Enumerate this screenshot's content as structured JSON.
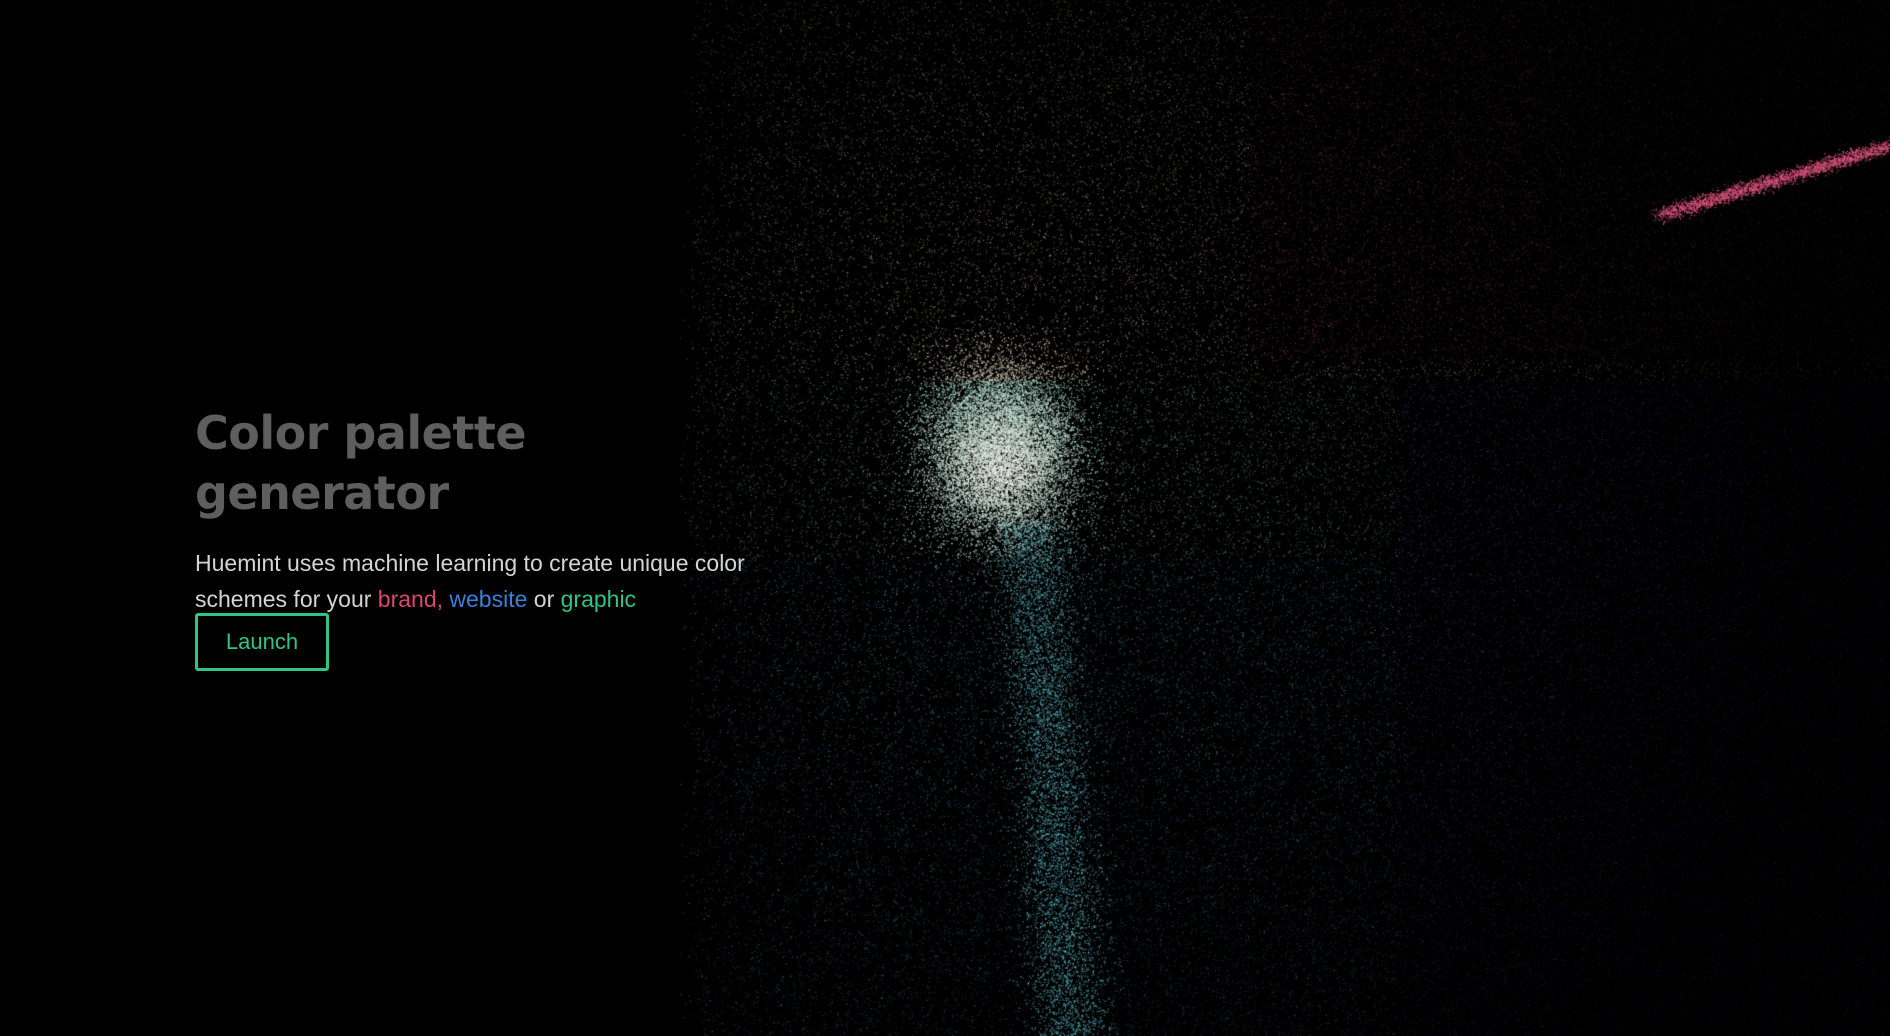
{
  "hero": {
    "title": "Color palette generator",
    "subtitle_prefix": "Huemint uses machine learning to create unique color schemes for your ",
    "keyword_brand": "brand,",
    "keyword_website": "website",
    "connector_or": "or",
    "keyword_graphic": "graphic",
    "launch_label": "Launch"
  },
  "colors": {
    "background": "#000000",
    "title": "#5e5e5e",
    "subtitle": "#d4d4d4",
    "brand": "#d9466f",
    "website": "#3b7fd6",
    "graphic": "#2ec486",
    "launch_accent": "#2ec486"
  }
}
